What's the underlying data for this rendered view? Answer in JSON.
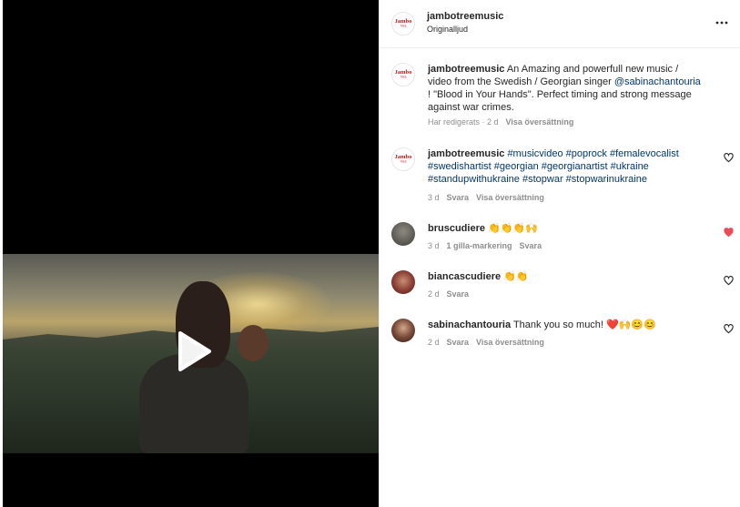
{
  "header": {
    "username": "jambotreemusic",
    "audio": "Originalljud"
  },
  "caption": {
    "username": "jambotreemusic",
    "text_part1": "An Amazing and powerfull new music / video from the Swedish / Georgian singer",
    "mention": "@sabinachantouria",
    "text_part2": "! \"Blood in Your Hands\". Perfect timing and strong message against war crimes.",
    "edited": "Har redigerats · 2 d",
    "translate": "Visa översättning"
  },
  "comments": [
    {
      "username": "jambotreemusic",
      "hashtags": [
        "#musicvideo",
        "#poprock",
        "#femalevocalist",
        "#swedishartist",
        "#georgian",
        "#georgianartist",
        "#ukraine",
        "#standupwithukraine",
        "#stopwar",
        "#stopwarinukraine"
      ],
      "age": "3 d",
      "reply": "Svara",
      "translate": "Visa översättning",
      "liked": false
    },
    {
      "username": "bruscudiere",
      "text": "👏👏👏🙌",
      "age": "3 d",
      "likes": "1 gilla-markering",
      "reply": "Svara",
      "liked": true
    },
    {
      "username": "biancascudiere",
      "text": "👏👏",
      "age": "2 d",
      "reply": "Svara",
      "liked": false
    },
    {
      "username": "sabinachantouria",
      "text": "Thank you so much! ❤️🙌😊😊",
      "age": "2 d",
      "reply": "Svara",
      "translate": "Visa översättning",
      "liked": false
    }
  ],
  "colors": {
    "link": "#00376b",
    "liked_heart": "#ed4956",
    "meta": "#8e8e8e"
  },
  "icons": {
    "play": "play-icon",
    "more": "more-options-icon",
    "heart": "heart-icon"
  }
}
